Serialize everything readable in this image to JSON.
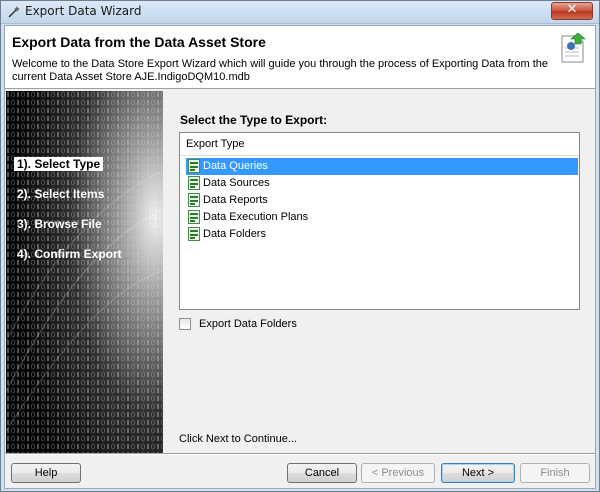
{
  "window": {
    "title": "Export Data Wizard"
  },
  "header": {
    "title": "Export Data from the Data Asset Store",
    "description": "Welcome to the Data Store Export Wizard which will guide you through the process of Exporting Data from the current Data Asset Store AJE.IndigoDQM10.mdb"
  },
  "steps": [
    {
      "label": "1). Select Type",
      "active": true
    },
    {
      "label": "2). Select Items",
      "active": false
    },
    {
      "label": "3). Browse File",
      "active": false
    },
    {
      "label": "4). Confirm Export",
      "active": false
    }
  ],
  "main": {
    "section_label": "Select the Type to Export:",
    "list_header": "Export Type",
    "items": [
      {
        "label": "Data Queries",
        "selected": true
      },
      {
        "label": "Data Sources",
        "selected": false
      },
      {
        "label": "Data Reports",
        "selected": false
      },
      {
        "label": "Data Execution Plans",
        "selected": false
      },
      {
        "label": "Data Folders",
        "selected": false
      }
    ],
    "checkbox_label": "Export Data Folders",
    "checkbox_checked": false,
    "continue_text": "Click Next to Continue..."
  },
  "buttons": {
    "help": "Help",
    "cancel": "Cancel",
    "previous": "< Previous",
    "next": "Next >",
    "finish": "Finish"
  }
}
